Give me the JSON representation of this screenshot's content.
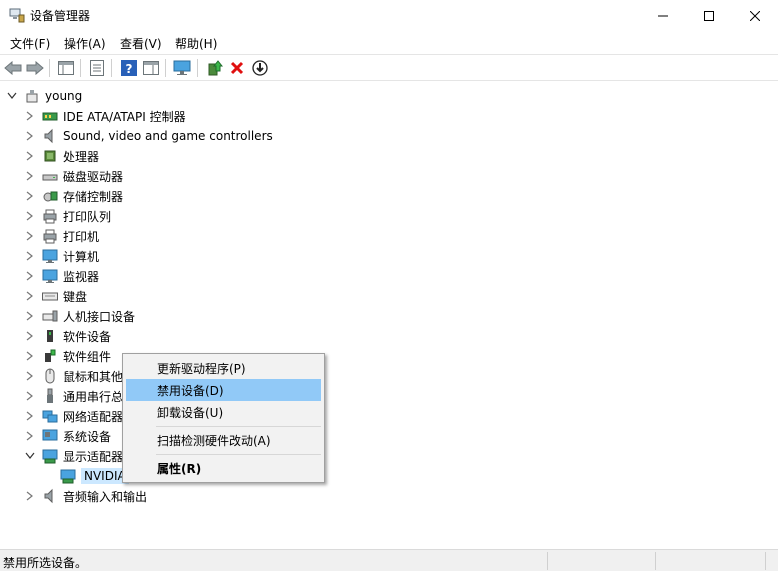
{
  "window": {
    "title": "设备管理器"
  },
  "menubar": {
    "items": [
      "文件(F)",
      "操作(A)",
      "查看(V)",
      "帮助(H)"
    ]
  },
  "tree": {
    "root": "young",
    "nodes": [
      {
        "label": "IDE ATA/ATAPI 控制器",
        "icon": "ide-controller-icon"
      },
      {
        "label": "Sound, video and game controllers",
        "icon": "speaker-icon"
      },
      {
        "label": "处理器",
        "icon": "cpu-icon"
      },
      {
        "label": "磁盘驱动器",
        "icon": "disk-drive-icon"
      },
      {
        "label": "存储控制器",
        "icon": "storage-controller-icon"
      },
      {
        "label": "打印队列",
        "icon": "print-queue-icon"
      },
      {
        "label": "打印机",
        "icon": "printer-icon"
      },
      {
        "label": "计算机",
        "icon": "computer-icon"
      },
      {
        "label": "监视器",
        "icon": "monitor-icon"
      },
      {
        "label": "键盘",
        "icon": "keyboard-icon"
      },
      {
        "label": "人机接口设备",
        "icon": "hid-icon"
      },
      {
        "label": "软件设备",
        "icon": "software-device-icon"
      },
      {
        "label": "软件组件",
        "icon": "software-component-icon"
      },
      {
        "label": "鼠标和其他",
        "icon": "mouse-icon"
      },
      {
        "label": "通用串行总",
        "icon": "usb-icon"
      },
      {
        "label": "网络适配器",
        "icon": "network-adapter-icon"
      },
      {
        "label": "系统设备",
        "icon": "system-device-icon"
      },
      {
        "label": "显示适配器",
        "icon": "display-adapter-icon"
      },
      {
        "label": "NVIDIA",
        "icon": "display-adapter-icon"
      },
      {
        "label": "音频输入和输出",
        "icon": "audio-io-icon"
      }
    ]
  },
  "context_menu": {
    "items": [
      "更新驱动程序(P)",
      "禁用设备(D)",
      "卸载设备(U)",
      "扫描检测硬件改动(A)",
      "属性(R)"
    ],
    "highlighted": "禁用设备(D)"
  },
  "statusbar": {
    "text": "禁用所选设备。"
  }
}
